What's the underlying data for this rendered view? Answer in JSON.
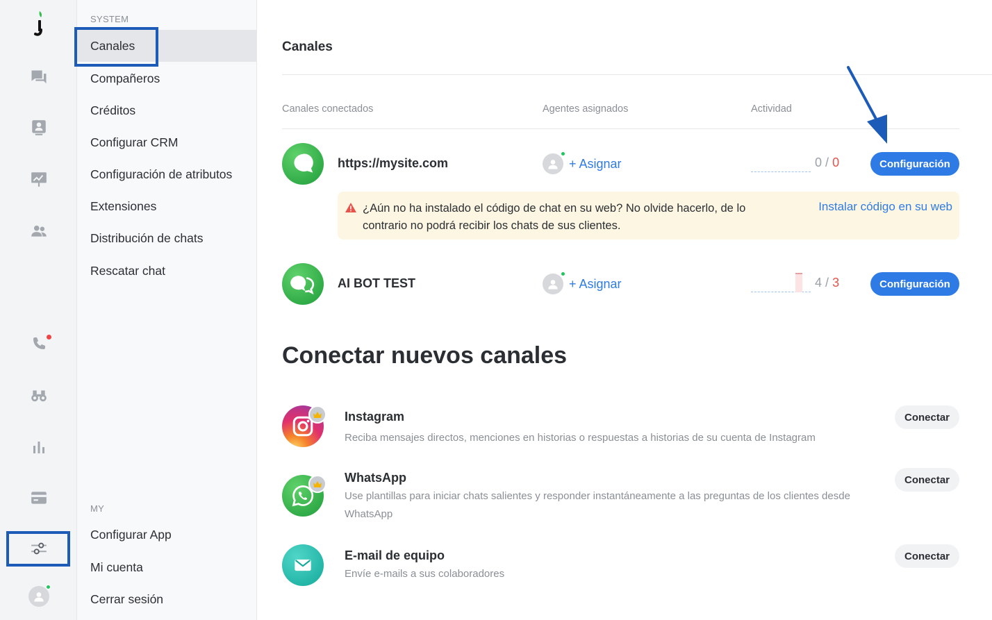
{
  "app": {
    "logo_letter": "j"
  },
  "menu": {
    "system_label": "SYSTEM",
    "system_items": [
      "Canales",
      "Compañeros",
      "Créditos",
      "Configurar CRM",
      "Configuración de atributos",
      "Extensiones",
      "Distribución de chats",
      "Rescatar chat"
    ],
    "active_item": "Canales",
    "my_label": "MY",
    "my_items": [
      "Configurar App",
      "Mi cuenta",
      "Cerrar sesión"
    ]
  },
  "main": {
    "title": "Canales",
    "columns": {
      "channels": "Canales conectados",
      "agents": "Agentes asignados",
      "activity": "Actividad"
    },
    "connected": [
      {
        "name": "https://mysite.com",
        "assign_label": "+ Asignar",
        "count_a": "0",
        "sep": "/",
        "count_b": "0",
        "config_label": "Configuración",
        "icon": "chat-bubble-icon"
      },
      {
        "name": "AI BOT TEST",
        "assign_label": "+ Asignar",
        "count_a": "4",
        "sep": "/",
        "count_b": "3",
        "config_label": "Configuración",
        "icon": "chat-bubbles-icon"
      }
    ],
    "warning": {
      "text": "¿Aún no ha instalado el código de chat en su web? No olvide hacerlo, de lo contrario no podrá recibir los chats de sus clientes.",
      "link": "Instalar código en su web"
    },
    "new_title": "Conectar nuevos canales",
    "new_channels": [
      {
        "name": "Instagram",
        "desc": "Reciba mensajes directos, menciones en historias o respuestas a historias de su cuenta de Instagram",
        "button": "Conectar",
        "icon": "instagram-icon"
      },
      {
        "name": "WhatsApp",
        "desc": "Use plantillas para iniciar chats salientes y responder instantáneamente a las preguntas de los clientes desde WhatsApp",
        "button": "Conectar",
        "icon": "whatsapp-icon"
      },
      {
        "name": "E-mail de equipo",
        "desc": "Envíe e-mails a sus colaboradores",
        "button": "Conectar",
        "icon": "mail-icon"
      }
    ]
  },
  "colors": {
    "accent": "#2f7be5",
    "highlight": "#1d5bb8",
    "warning_bg": "#fdf6e3",
    "alert": "#e5534b",
    "online": "#22c55e"
  }
}
